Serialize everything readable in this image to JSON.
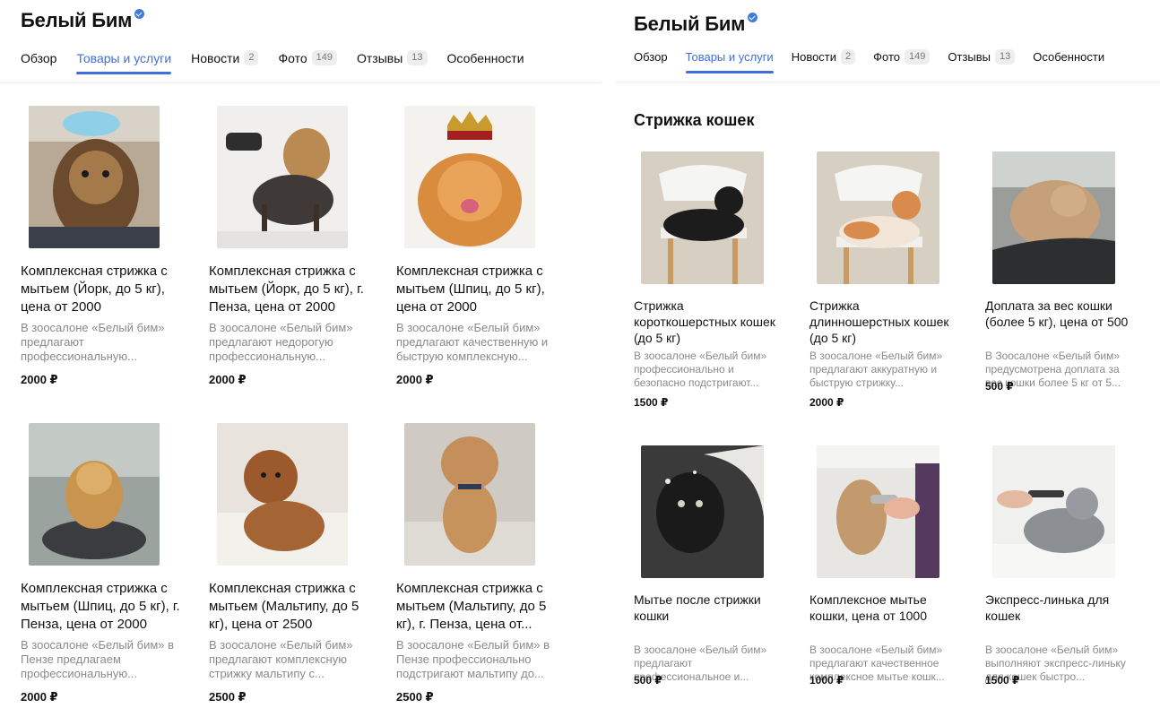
{
  "left": {
    "org": {
      "title": "Белый Бим"
    },
    "tabs": [
      {
        "label": "Обзор",
        "count": ""
      },
      {
        "label": "Товары и услуги",
        "count": ""
      },
      {
        "label": "Новости",
        "count": "2"
      },
      {
        "label": "Фото",
        "count": "149"
      },
      {
        "label": "Отзывы",
        "count": "13"
      },
      {
        "label": "Особенности",
        "count": ""
      }
    ],
    "cards": [
      {
        "title": "Комплексная стрижка с мытьем (Йорк, до 5 кг), цена от 2000",
        "desc": "В зоосалоне «Белый бим» предлагают профессиональную...",
        "price": "2000 ₽"
      },
      {
        "title": "Комплексная стрижка с мытьем (Йорк, до 5 кг), г. Пенза, цена от 2000",
        "desc": "В зоосалоне «Белый бим» предлагают недорогую профессиональную...",
        "price": "2000 ₽"
      },
      {
        "title": "Комплексная стрижка с мытьем (Шпиц, до 5 кг), цена от 2000",
        "desc": "В зоосалоне «Белый бим» предлагают качественную и быструю комплексную...",
        "price": "2000 ₽"
      },
      {
        "title": "Комплексная стрижка с мытьем (Шпиц, до 5 кг), г. Пенза, цена от 2000",
        "desc": "В зоосалоне «Белый бим» в Пензе предлагаем профессиональную...",
        "price": "2000 ₽"
      },
      {
        "title": "Комплексная стрижка с мытьем (Мальтипу, до 5 кг), цена от 2500",
        "desc": "В зоосалоне «Белый бим» предлагают комплексную стрижку мальтипу с...",
        "price": "2500 ₽"
      },
      {
        "title": "Комплексная стрижка с мытьем (Мальтипу, до 5 кг), г. Пенза, цена от...",
        "desc": "В зоосалоне «Белый бим» в Пензе профессионально подстригают мальтипу до...",
        "price": "2500 ₽"
      }
    ]
  },
  "right": {
    "org": {
      "title": "Белый Бим"
    },
    "tabs": [
      {
        "label": "Обзор",
        "count": ""
      },
      {
        "label": "Товары и услуги",
        "count": ""
      },
      {
        "label": "Новости",
        "count": "2"
      },
      {
        "label": "Фото",
        "count": "149"
      },
      {
        "label": "Отзывы",
        "count": "13"
      },
      {
        "label": "Особенности",
        "count": ""
      }
    ],
    "section_title": "Стрижка кошек",
    "cards": [
      {
        "title": "Стрижка короткошерстных кошек (до 5 кг)",
        "desc": "В зоосалоне «Белый бим» профессионально и безопасно подстригают...",
        "price": "1500 ₽"
      },
      {
        "title": "Стрижка длинношерстных кошек (до 5 кг)",
        "desc": "В зоосалоне «Белый бим» предлагают аккуратную и быструю стрижку...",
        "price": "2000 ₽"
      },
      {
        "title": "Доплата за вес кошки (более 5 кг), цена от 500",
        "desc": "В Зоосалоне «Белый бим» предусмотрена доплата за вес кошки более 5 кг от 5...",
        "price": "500 ₽"
      },
      {
        "title": "Мытье после стрижки кошки",
        "desc": "В зоосалоне «Белый бим» предлагают профессиональное и...",
        "price": "500 ₽"
      },
      {
        "title": "Комплексное мытье кошки, цена от 1000",
        "desc": "В зоосалоне «Белый бим» предлагают качественное комплексное мытье кошк...",
        "price": "1000 ₽"
      },
      {
        "title": "Экспресс-линька для кошек",
        "desc": "В зоосалоне «Белый бим» выполняют экспресс-линьку для кошек быстро...",
        "price": "1500 ₽"
      }
    ]
  },
  "colors": {
    "accent": "#3f6fdb",
    "verified": "#3f7bd9",
    "muted_text": "#8a8a8a"
  }
}
